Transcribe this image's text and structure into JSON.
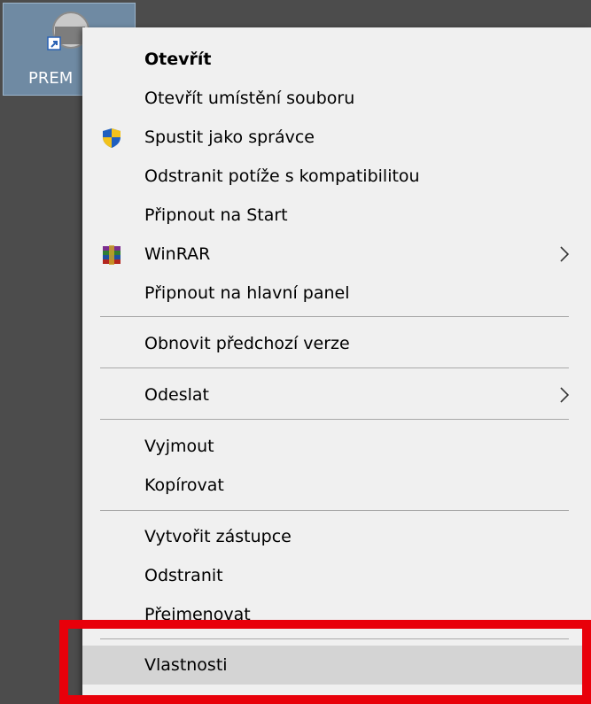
{
  "desktop": {
    "icon_label": "PREM",
    "icon_name": "premiere-shortcut-icon"
  },
  "menu": {
    "items": [
      {
        "label": "Otevřít",
        "bold": true
      },
      {
        "label": "Otevřít umístění souboru"
      },
      {
        "label": "Spustit jako správce",
        "icon": "uac-shield-icon"
      },
      {
        "label": "Odstranit potíže s kompatibilitou"
      },
      {
        "label": "Připnout na Start"
      },
      {
        "label": "WinRAR",
        "icon": "winrar-icon",
        "submenu": true
      },
      {
        "label": "Připnout na hlavní panel"
      },
      {
        "label": "Obnovit předchozí verze"
      },
      {
        "label": "Odeslat",
        "submenu": true
      },
      {
        "label": "Vyjmout"
      },
      {
        "label": "Kopírovat"
      },
      {
        "label": "Vytvořit zástupce"
      },
      {
        "label": "Odstranit"
      },
      {
        "label": "Přejmenovat"
      },
      {
        "label": "Vlastnosti",
        "hovered": true
      }
    ]
  },
  "colors": {
    "menu_bg": "#f0f0f0",
    "hover_bg": "#d4d4d4",
    "highlight_border": "#e8000a",
    "desktop_bg": "#4c4c4c"
  }
}
